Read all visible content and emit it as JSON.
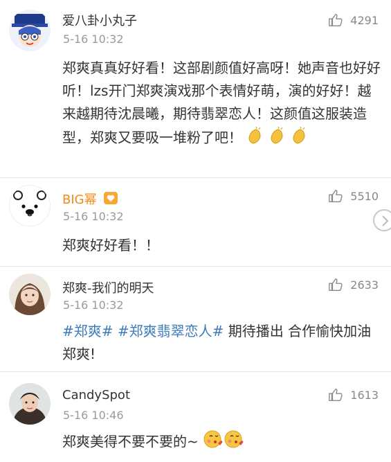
{
  "comments": [
    {
      "username": "爱八卦小丸子",
      "time": "5-16 10:32",
      "likes": "4291",
      "text": "郑爽真真好好看！这部剧颜值好高呀！她声音也好好听！lzs开门郑爽演戏那个表情好萌，演的好好！越来越期待沈晨曦，期待翡翠恋人！这颜值这服装造型，郑爽又要吸一堆粉了吧！",
      "emoji": "clap-icon"
    },
    {
      "username": "BIG幂",
      "time": "5-16 10:32",
      "likes": "5510",
      "text": "郑爽好好看！！"
    },
    {
      "username": "郑爽-我们的明天",
      "time": "5-16 10:32",
      "likes": "2633",
      "tag1": "#郑爽#",
      "tag2": "#郑爽翡翠恋人#",
      "text": "期待播出 合作愉快加油 郑爽!"
    },
    {
      "username": "CandySpot",
      "time": "5-16 10:46",
      "likes": "1613",
      "text": "郑爽美得不要不要的~",
      "emoji": "kiss-face-icon"
    }
  ],
  "colors": {
    "tag": "#3d7bb8",
    "username_highlight": "#f28a1a",
    "secondary": "#9a9a9a"
  }
}
